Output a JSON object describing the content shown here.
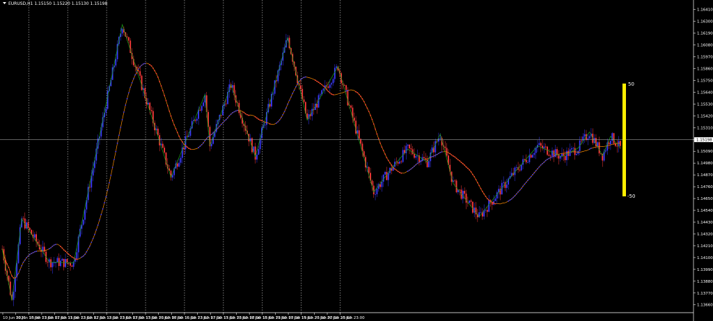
{
  "window": {
    "title": "EURUSD,H1  1.15150 1.15220 1.15130 1.15198"
  },
  "colors": {
    "background": "#000000",
    "bull": "#3a3aff",
    "bear": "#ff3a3a",
    "zigzag": "#1aa51a",
    "ma": "#ff8c00",
    "grid": "#ffffff",
    "indicator_bar": "#ffee00",
    "price_box_bg": "#ffffff",
    "price_box_text": "#000000"
  },
  "chart_data": {
    "type": "candlestick",
    "symbol": "EURUSD",
    "timeframe": "H1",
    "ohlc_header": {
      "open": 1.1515,
      "high": 1.1522,
      "low": 1.1513,
      "close": 1.15198
    },
    "current_price_label": "1.15198",
    "current_price": 1.15198,
    "ylim": [
      1.136,
      1.1646
    ],
    "y_ticks": [
      "1.16410",
      "1.16300",
      "1.16190",
      "1.16080",
      "1.15970",
      "1.15860",
      "1.15750",
      "1.15640",
      "1.15530",
      "1.15420",
      "1.15310",
      "1.15200",
      "1.15090",
      "1.14980",
      "1.14870",
      "1.14760",
      "1.14650",
      "1.14540",
      "1.14430",
      "1.14320",
      "1.14210",
      "1.14100",
      "1.13990",
      "1.13880",
      "1.13770",
      "1.13660"
    ],
    "x_ticks": [
      "10 Jun 2025",
      "10 Jun 15:00",
      "10 Jun 23:00",
      "11 Jun 07:00",
      "11 Jun 15:00",
      "11 Jun 23:00",
      "12 Jun 07:00",
      "12 Jun 15:00",
      "12 Jun 23:00",
      "13 Jun 07:00",
      "13 Jun 15:00",
      "13 Jun 23:00",
      "16 Jun 07:00",
      "16 Jun 15:00",
      "16 Jun 23:00",
      "17 Jun 07:00",
      "17 Jun 15:00",
      "17 Jun 23:00",
      "18 Jun 07:00",
      "18 Jun 15:00",
      "18 Jun 23:00",
      "19 Jun 07:00",
      "19 Jun 15:00",
      "19 Jun 23:00",
      "20 Jun 07:00",
      "20 Jun 15:00",
      "20 Jun 23:00"
    ],
    "day_separators": [
      "10 Jun 23:00",
      "11 Jun 23:00",
      "12 Jun 23:00",
      "13 Jun 23:00",
      "16 Jun 23:00",
      "17 Jun 23:00",
      "18 Jun 23:00",
      "19 Jun 23:00",
      "20 Jun 23:00"
    ],
    "zigzag": [
      {
        "bar": 0,
        "price": 1.1418
      },
      {
        "bar": 6,
        "price": 1.137
      },
      {
        "bar": 12,
        "price": 1.1446
      },
      {
        "bar": 29,
        "price": 1.1406
      },
      {
        "bar": 44,
        "price": 1.1405
      },
      {
        "bar": 74,
        "price": 1.1627
      },
      {
        "bar": 104,
        "price": 1.1485
      },
      {
        "bar": 125,
        "price": 1.1562
      },
      {
        "bar": 128,
        "price": 1.1514
      },
      {
        "bar": 141,
        "price": 1.1571
      },
      {
        "bar": 156,
        "price": 1.1504
      },
      {
        "bar": 176,
        "price": 1.1615
      },
      {
        "bar": 188,
        "price": 1.1538
      },
      {
        "bar": 207,
        "price": 1.1588
      },
      {
        "bar": 229,
        "price": 1.1471
      },
      {
        "bar": 240,
        "price": 1.1493
      },
      {
        "bar": 250,
        "price": 1.1511
      },
      {
        "bar": 262,
        "price": 1.1499
      },
      {
        "bar": 270,
        "price": 1.1525
      },
      {
        "bar": 278,
        "price": 1.1479
      },
      {
        "bar": 294,
        "price": 1.1448
      },
      {
        "bar": 315,
        "price": 1.1488
      },
      {
        "bar": 330,
        "price": 1.1514
      },
      {
        "bar": 345,
        "price": 1.1504
      },
      {
        "bar": 355,
        "price": 1.1512
      },
      {
        "bar": 362,
        "price": 1.1527
      },
      {
        "bar": 370,
        "price": 1.1505
      },
      {
        "bar": 375,
        "price": 1.1523
      },
      {
        "bar": 381,
        "price": 1.1512
      }
    ],
    "indicator": {
      "type": "vertical_bar",
      "upper_label": "50",
      "lower_label": "-50"
    }
  }
}
